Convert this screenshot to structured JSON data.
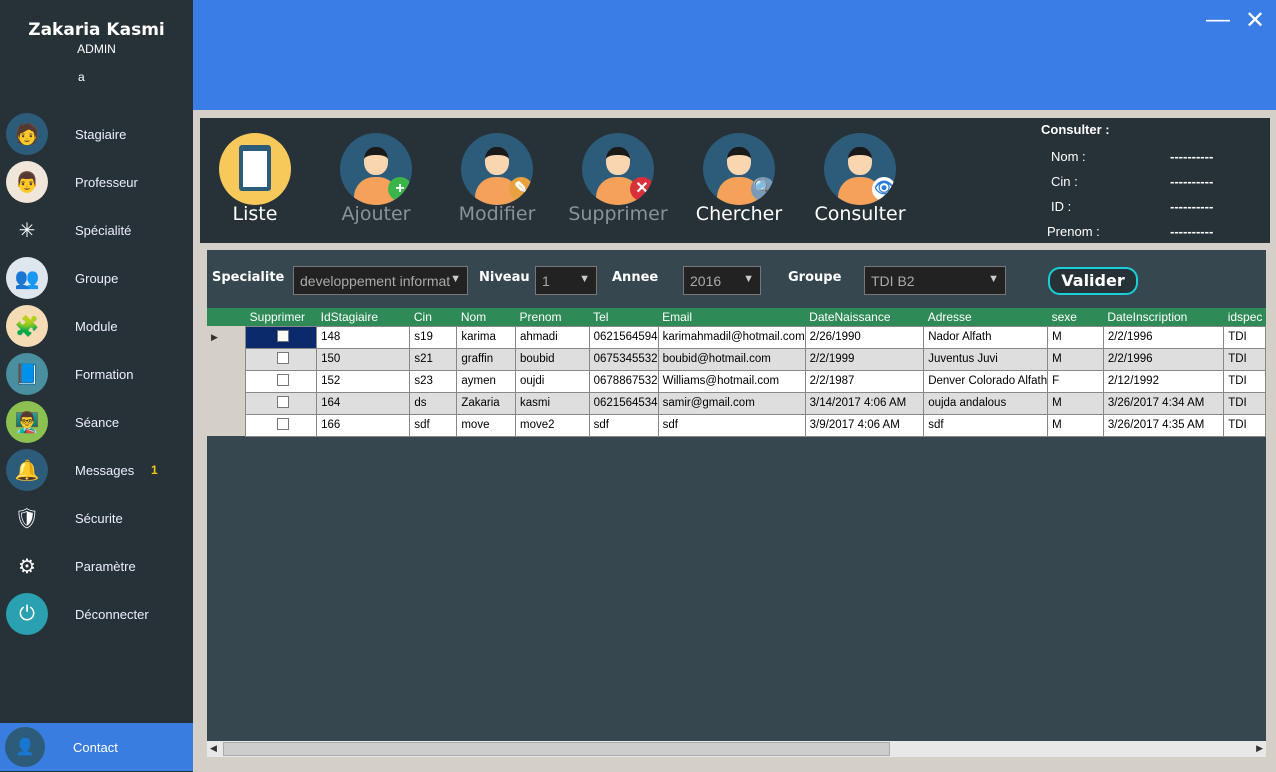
{
  "user": {
    "name": "Zakaria Kasmi",
    "role": "ADMIN",
    "extra": "a"
  },
  "sidebar": {
    "items": [
      {
        "label": "Stagiaire",
        "icon": "student-icon"
      },
      {
        "label": "Professeur",
        "icon": "teacher-icon"
      },
      {
        "label": "Spécialité",
        "icon": "network-icon"
      },
      {
        "label": "Groupe",
        "icon": "group-icon"
      },
      {
        "label": "Module",
        "icon": "puzzle-icon"
      },
      {
        "label": "Formation",
        "icon": "book-icon"
      },
      {
        "label": "Séance",
        "icon": "presentation-icon"
      },
      {
        "label": "Messages",
        "icon": "bell-icon",
        "badge": "1"
      },
      {
        "label": "Sécurite",
        "icon": "shield-icon"
      },
      {
        "label": "Paramètre",
        "icon": "gear-icon"
      },
      {
        "label": "Déconnecter",
        "icon": "power-icon"
      }
    ],
    "contact": "Contact"
  },
  "window": {
    "minimize": "—",
    "close": "✕"
  },
  "actions": [
    {
      "label": "Liste"
    },
    {
      "label": "Ajouter"
    },
    {
      "label": "Modifier"
    },
    {
      "label": "Supprimer"
    },
    {
      "label": "Chercher"
    },
    {
      "label": "Consulter"
    }
  ],
  "consulter": {
    "title": "Consulter :",
    "fields": [
      {
        "label": "Nom :",
        "value": "----------"
      },
      {
        "label": "Cin :",
        "value": "----------"
      },
      {
        "label": "ID :",
        "value": "----------"
      },
      {
        "label": "Prenom :",
        "value": "----------"
      }
    ]
  },
  "filters": {
    "specialite_label": "Specialite",
    "specialite": "developpement informat",
    "niveau_label": "Niveau",
    "niveau": "1",
    "annee_label": "Annee",
    "annee": "2016",
    "groupe_label": "Groupe",
    "groupe": "TDI B2",
    "valider": "Valider"
  },
  "table": {
    "columns": [
      "Supprimer",
      "IdStagiaire",
      "Cin",
      "Nom",
      "Prenom",
      "Tel",
      "Email",
      "DateNaissance",
      "Adresse",
      "sexe",
      "DateInscription",
      "idspec"
    ],
    "rows": [
      [
        "148",
        "s19",
        "karima",
        "ahmadi",
        "0621564594",
        "karimahmadil@hotmail.com",
        "2/26/1990",
        "Nador Alfath",
        "M",
        "2/2/1996",
        "TDI"
      ],
      [
        "150",
        "s21",
        "graffin",
        "boubid",
        "0675345532",
        "boubid@hotmail.com",
        "2/2/1999",
        "Juventus Juvi",
        "M",
        "2/2/1996",
        "TDI"
      ],
      [
        "152",
        "s23",
        "aymen",
        "oujdi",
        "0678867532",
        "Williams@hotmail.com",
        "2/2/1987",
        "Denver Colorado Alfath",
        "F",
        "2/12/1992",
        "TDI"
      ],
      [
        "164",
        "ds",
        "Zakaria",
        "kasmi",
        "0621564534",
        "samir@gmail.com",
        "3/14/2017 4:06 AM",
        "oujda andalous",
        "M",
        "3/26/2017 4:34 AM",
        "TDI"
      ],
      [
        "166",
        "sdf",
        "move",
        "move2",
        "sdf",
        "sdf",
        "3/9/2017 4:06 AM",
        "sdf",
        "M",
        "3/26/2017 4:35 AM",
        "TDI"
      ]
    ]
  },
  "colors": {
    "sidebar": "#263238",
    "accent": "#3b7de6",
    "header": "#2e8b57"
  }
}
